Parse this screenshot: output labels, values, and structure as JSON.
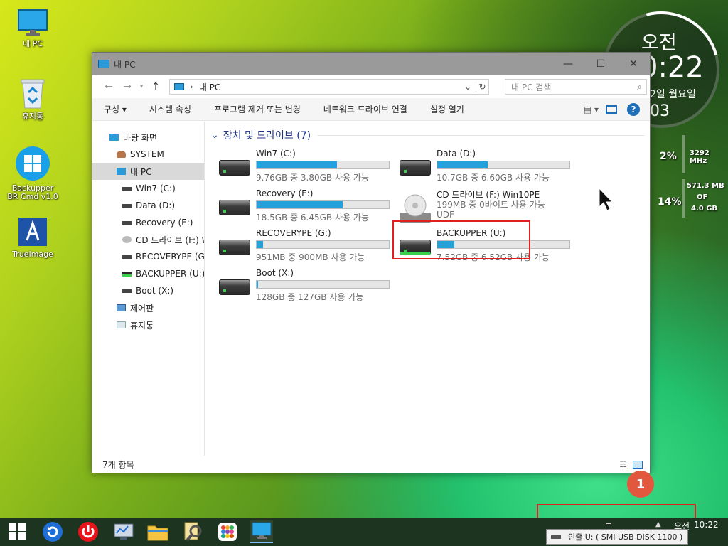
{
  "desktop_icons": {
    "my_pc": "내 PC",
    "recycle": "휴지통",
    "backupper": "Backupper BR Cmd v1.0",
    "trueimage": "TrueImage"
  },
  "widget": {
    "ampm": "오전",
    "time": "0:22",
    "date": "2일 월요일",
    "extra": "03",
    "cpu_pct": "2%",
    "cpu_freq": "3292 MHz",
    "mem_pct": "14%",
    "mem_used": "571.3 MB",
    "mem_of": "OF",
    "mem_total": "4.0 GB"
  },
  "window": {
    "title": "내 PC",
    "min": "—",
    "max": "☐",
    "close": "✕",
    "address": "내 PC",
    "search_placeholder": "내 PC 검색",
    "commands": [
      "구성 ▾",
      "시스템 속성",
      "프로그램 제거 또는 변경",
      "네트워크 드라이브 연결",
      "설정 열기"
    ],
    "nav": [
      "바탕 화면",
      "SYSTEM",
      "내 PC",
      "Win7 (C:)",
      "Data (D:)",
      "Recovery (E:)",
      "CD 드라이브 (F:) Win10PE",
      "RECOVERYPE (G:)",
      "BACKUPPER (U:)",
      "Boot (X:)",
      "제어판",
      "휴지통"
    ],
    "section": "장치 및 드라이브 (7)",
    "status": "7개 항목",
    "drives": [
      {
        "name": "Win7 (C:)",
        "free": "9.76GB 중 3.80GB 사용 가능",
        "used": 0.61
      },
      {
        "name": "Data (D:)",
        "free": "10.7GB 중 6.60GB 사용 가능",
        "used": 0.38
      },
      {
        "name": "Recovery (E:)",
        "free": "18.5GB 중 6.45GB 사용 가능",
        "used": 0.65
      },
      {
        "name": "CD 드라이브 (F:) Win10PE",
        "free": "199MB 중 0바이트 사용 가능",
        "fs": "UDF"
      },
      {
        "name": "RECOVERYPE (G:)",
        "free": "951MB 중 900MB 사용 가능",
        "used": 0.05
      },
      {
        "name": "BACKUPPER (U:)",
        "free": "7.52GB 중 6.52GB 사용 가능",
        "used": 0.13
      },
      {
        "name": "Boot (X:)",
        "free": "128GB 중 127GB 사용 가능",
        "used": 0.01
      }
    ]
  },
  "taskbar": {
    "clock_ampm": "오전",
    "clock_time": "10:22",
    "eject_notice": "인출 U: ( SMI USB DISK 1100 )"
  },
  "annotation": {
    "badge": "1"
  },
  "colors": {
    "accent": "#26a0da",
    "highlight": "#e02020",
    "badge": "#e2583e"
  }
}
